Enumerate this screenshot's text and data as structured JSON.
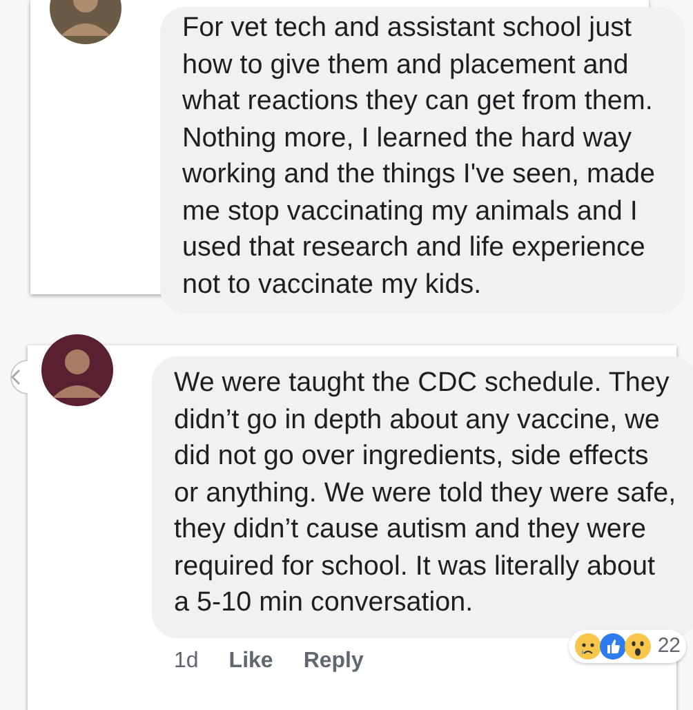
{
  "comments": [
    {
      "text": "For vet tech and assistant school  just how to give them and placement and what reactions they can get from them. Nothing more, I learned the hard way working and the things I've seen, made me stop vaccinating my animals and I used that research and life experience not to vaccinate my kids."
    },
    {
      "text": "We were taught the CDC schedule. They didn’t go in depth about any vaccine, we did not go over ingredients, side effects or anything. We were told they were safe, they didn’t cause autism and they were required for school. It was literally about a 5-10 min conversation.",
      "time": "1d",
      "actions": [
        "Like",
        "Reply"
      ],
      "reactions": [
        {
          "kind": "sad"
        },
        {
          "kind": "like"
        },
        {
          "kind": "wow"
        }
      ],
      "reaction_count": "22"
    }
  ]
}
